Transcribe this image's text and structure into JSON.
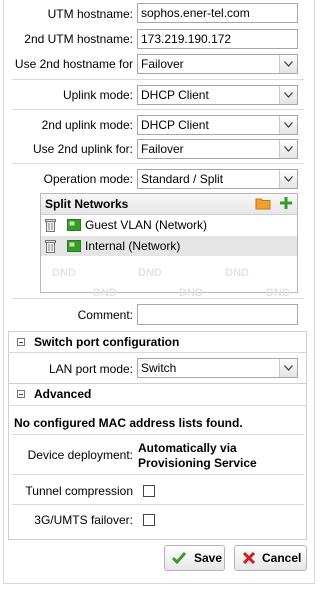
{
  "form": {
    "utm_hostname": {
      "label": "UTM hostname:",
      "value": "sophos.ener-tel.com"
    },
    "second_utm_hostname": {
      "label": "2nd UTM hostname:",
      "value": "173.219.190.172"
    },
    "use_second_hostname_for": {
      "label": "Use 2nd hostname for",
      "value": "Failover"
    },
    "uplink_mode": {
      "label": "Uplink mode:",
      "value": "DHCP Client"
    },
    "second_uplink_mode": {
      "label": "2nd uplink mode:",
      "value": "DHCP Client"
    },
    "use_second_uplink_for": {
      "label": "Use 2nd uplink for:",
      "value": "Failover"
    },
    "operation_mode": {
      "label": "Operation mode:",
      "value": "Standard / Split"
    },
    "split_networks": {
      "title": "Split Networks",
      "items": [
        {
          "label": "Guest VLAN (Network)"
        },
        {
          "label": "Internal (Network)"
        }
      ],
      "dnd_text": "DND"
    },
    "comment": {
      "label": "Comment:",
      "value": ""
    }
  },
  "switch_port": {
    "title": "Switch port configuration",
    "lan_port_mode": {
      "label": "LAN port mode:",
      "value": "Switch"
    }
  },
  "advanced": {
    "title": "Advanced",
    "mac_notice": "No configured MAC address lists found.",
    "device_deployment": {
      "label": "Device deployment:",
      "value_line1": "Automatically via",
      "value_line2": "Provisioning Service"
    },
    "tunnel_compression": {
      "label": "Tunnel compression",
      "checked": false
    },
    "umts_failover": {
      "label": "3G/UMTS failover:",
      "checked": false
    }
  },
  "buttons": {
    "save": "Save",
    "cancel": "Cancel"
  },
  "colors": {
    "accent_green": "#3a9a2a",
    "cancel_red": "#cc2222",
    "folder_orange": "#f0a030"
  }
}
